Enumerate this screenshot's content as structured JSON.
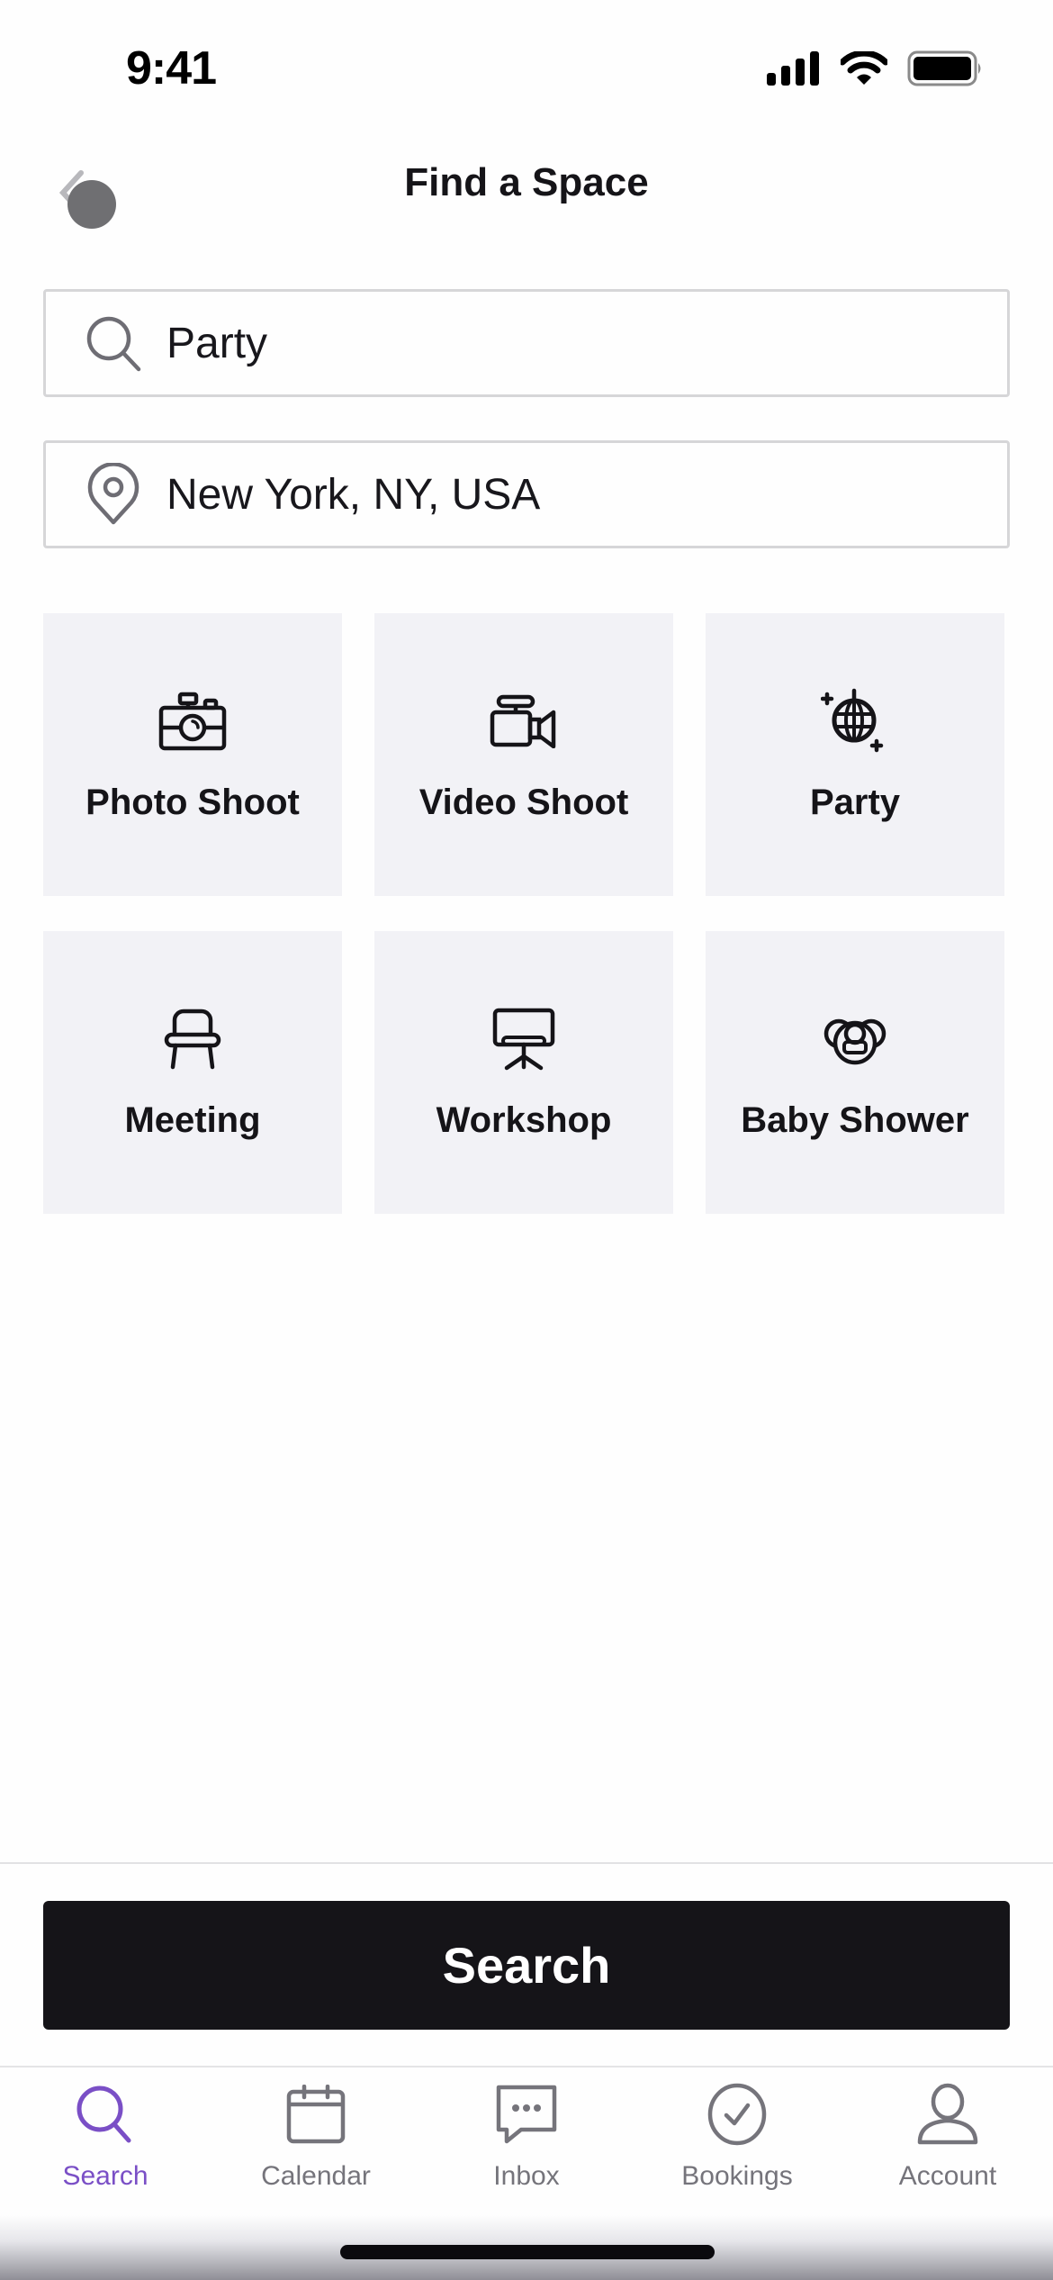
{
  "status_bar": {
    "time": "9:41",
    "icons": [
      "cellular-signal-icon",
      "wifi-icon",
      "battery-icon"
    ]
  },
  "nav": {
    "title": "Find a Space",
    "back_icon": "chevron-left-icon"
  },
  "search_field": {
    "icon": "search-icon",
    "value": "Party"
  },
  "location_field": {
    "icon": "location-pin-icon",
    "value": "New York, NY, USA"
  },
  "categories": [
    {
      "label": "Photo Shoot",
      "icon": "camera-icon"
    },
    {
      "label": "Video Shoot",
      "icon": "video-camera-icon"
    },
    {
      "label": "Party",
      "icon": "disco-ball-icon"
    },
    {
      "label": "Meeting",
      "icon": "chair-icon"
    },
    {
      "label": "Workshop",
      "icon": "presentation-board-icon"
    },
    {
      "label": "Baby Shower",
      "icon": "pacifier-icon"
    }
  ],
  "search_button": {
    "label": "Search"
  },
  "tab_bar": {
    "active_color": "#7a4fc6",
    "inactive_color": "#75747b",
    "tabs": [
      {
        "label": "Search",
        "icon": "search-icon",
        "active": true
      },
      {
        "label": "Calendar",
        "icon": "calendar-icon",
        "active": false
      },
      {
        "label": "Inbox",
        "icon": "chat-bubble-icon",
        "active": false
      },
      {
        "label": "Bookings",
        "icon": "check-circle-icon",
        "active": false
      },
      {
        "label": "Account",
        "icon": "person-icon",
        "active": false
      }
    ]
  }
}
